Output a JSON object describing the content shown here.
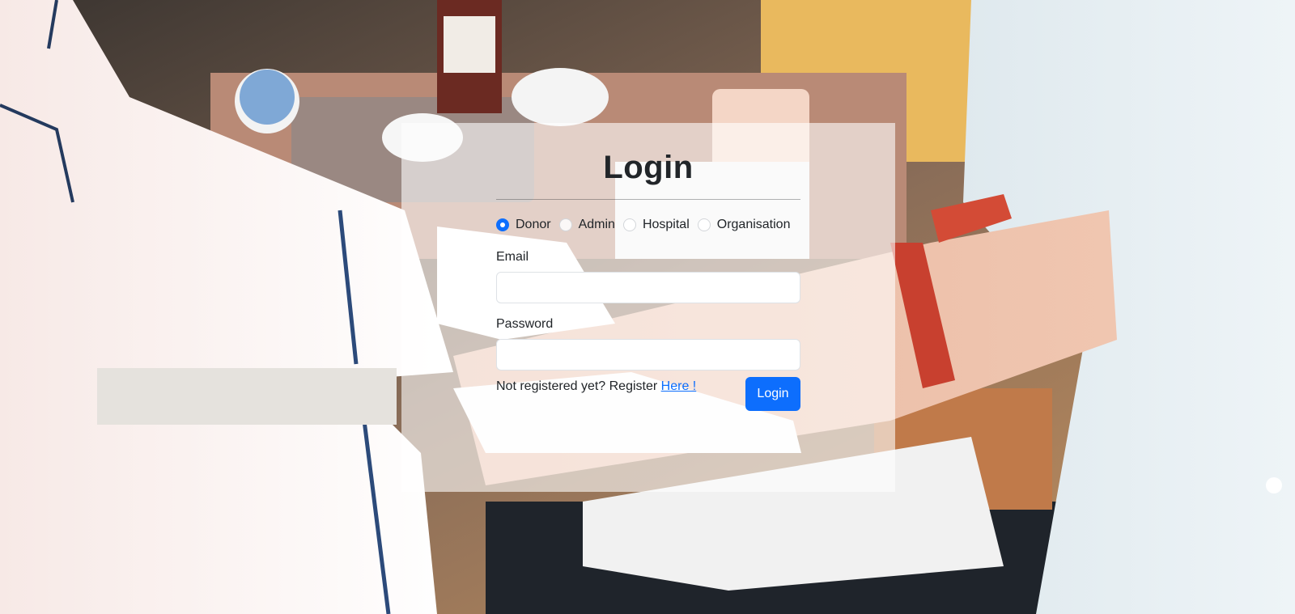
{
  "login": {
    "title": "Login",
    "roles": [
      {
        "label": "Donor",
        "checked": true
      },
      {
        "label": "Admin",
        "checked": false
      },
      {
        "label": "Hospital",
        "checked": false
      },
      {
        "label": "Organisation",
        "checked": false
      }
    ],
    "email_label": "Email",
    "email_value": "",
    "password_label": "Password",
    "password_value": "",
    "register_prompt": "Not registered yet? Register ",
    "register_link": "Here !",
    "submit_label": "Login"
  },
  "colors": {
    "accent": "#0d6efd",
    "text": "#212529",
    "card_background": "rgba(255,255,255,0.60)"
  }
}
